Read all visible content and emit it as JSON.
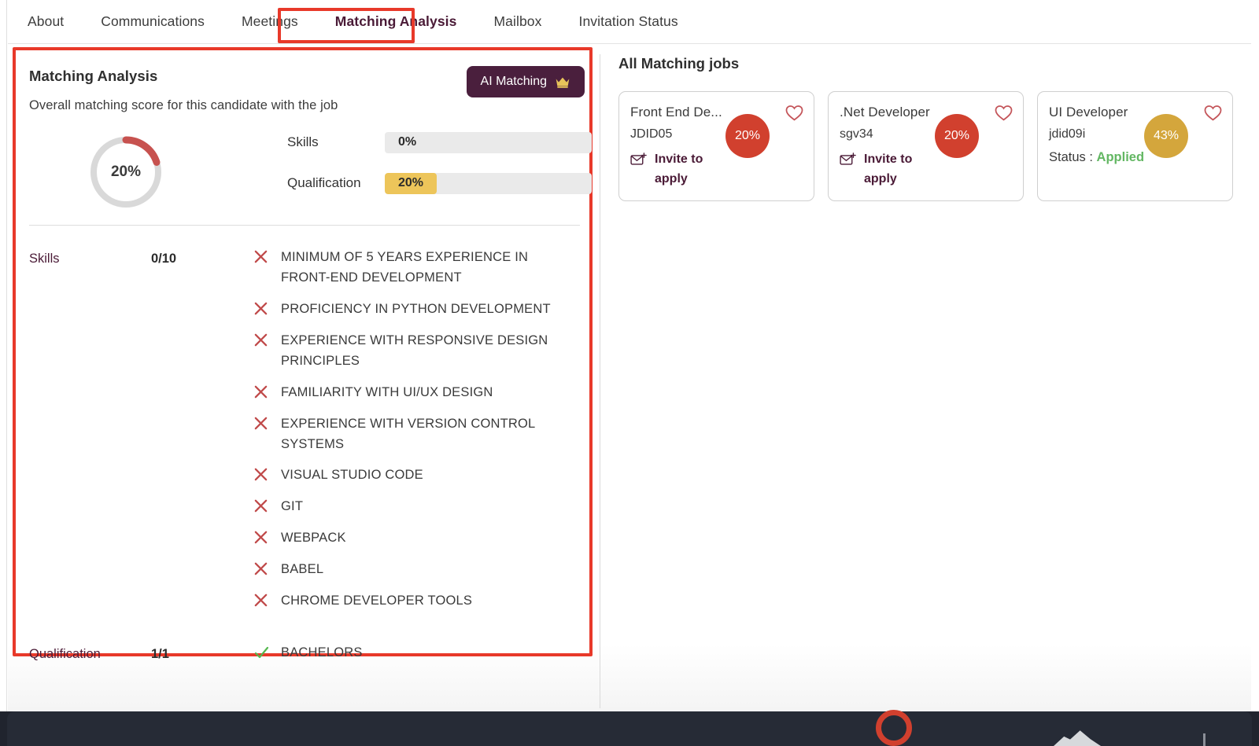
{
  "tabs": [
    {
      "label": "About",
      "active": false
    },
    {
      "label": "Communications",
      "active": false
    },
    {
      "label": "Meetings",
      "active": false
    },
    {
      "label": "Matching Analysis",
      "active": true
    },
    {
      "label": "Mailbox",
      "active": false
    },
    {
      "label": "Invitation Status",
      "active": false
    }
  ],
  "panel": {
    "title": "Matching Analysis",
    "subtitle": "Overall matching score for this candidate with the job",
    "ai_button": "AI Matching",
    "ai_button_icon": "crown-icon"
  },
  "score": {
    "overall_label": "20%",
    "overall_value": 20,
    "donut_track_color": "#d9d9d9",
    "donut_arc_color": "#c7524f",
    "bars": [
      {
        "label": "Skills",
        "value_label": "0%",
        "value": 0,
        "color": "#eaeaea"
      },
      {
        "label": "Qualification",
        "value_label": "20%",
        "value": 20,
        "color": "#edc55a"
      }
    ]
  },
  "criteria": [
    {
      "name": "Skills",
      "score": "0/10",
      "items": [
        {
          "text": "MINIMUM OF 5 YEARS EXPERIENCE IN FRONT-END DEVELOPMENT",
          "mark": "cross-icon"
        },
        {
          "text": "PROFICIENCY IN PYTHON DEVELOPMENT",
          "mark": "cross-icon"
        },
        {
          "text": "EXPERIENCE WITH RESPONSIVE DESIGN PRINCIPLES",
          "mark": "cross-icon"
        },
        {
          "text": "FAMILIARITY WITH UI/UX DESIGN",
          "mark": "cross-icon"
        },
        {
          "text": "EXPERIENCE WITH VERSION CONTROL SYSTEMS",
          "mark": "cross-icon"
        },
        {
          "text": "VISUAL STUDIO CODE",
          "mark": "cross-icon"
        },
        {
          "text": "GIT",
          "mark": "cross-icon"
        },
        {
          "text": "WEBPACK",
          "mark": "cross-icon"
        },
        {
          "text": "BABEL",
          "mark": "cross-icon"
        },
        {
          "text": "CHROME DEVELOPER TOOLS",
          "mark": "cross-icon"
        }
      ]
    },
    {
      "name": "Qualification",
      "score": "1/1",
      "items": [
        {
          "text": "BACHELORS",
          "mark": "check-icon"
        }
      ]
    }
  ],
  "jobs": {
    "title": "All Matching jobs",
    "cards": [
      {
        "title": "Front End De...",
        "id": "JDID05",
        "action": "Invite to apply",
        "action_icon": "envelope-plus-icon",
        "pct": "20%",
        "pct_color": "#d1402e",
        "heart_icon": "heart-outline-icon",
        "status_prefix": null,
        "status_value": null
      },
      {
        "title": ".Net Developer",
        "id": "sgv34",
        "action": "Invite to apply",
        "action_icon": "envelope-plus-icon",
        "pct": "20%",
        "pct_color": "#d1402e",
        "heart_icon": "heart-outline-icon",
        "status_prefix": null,
        "status_value": null
      },
      {
        "title": "UI Developer",
        "id": "jdid09i",
        "action": null,
        "action_icon": null,
        "pct": "43%",
        "pct_color": "#d4a63c",
        "heart_icon": "heart-outline-icon",
        "status_prefix": "Status : ",
        "status_value": "Applied"
      }
    ]
  },
  "colors": {
    "annotation": "#e8392a",
    "brand_dark": "#4a1f3d",
    "accent_gold": "#edc55a",
    "accent_red": "#d1402e",
    "status_green": "#63b763"
  }
}
